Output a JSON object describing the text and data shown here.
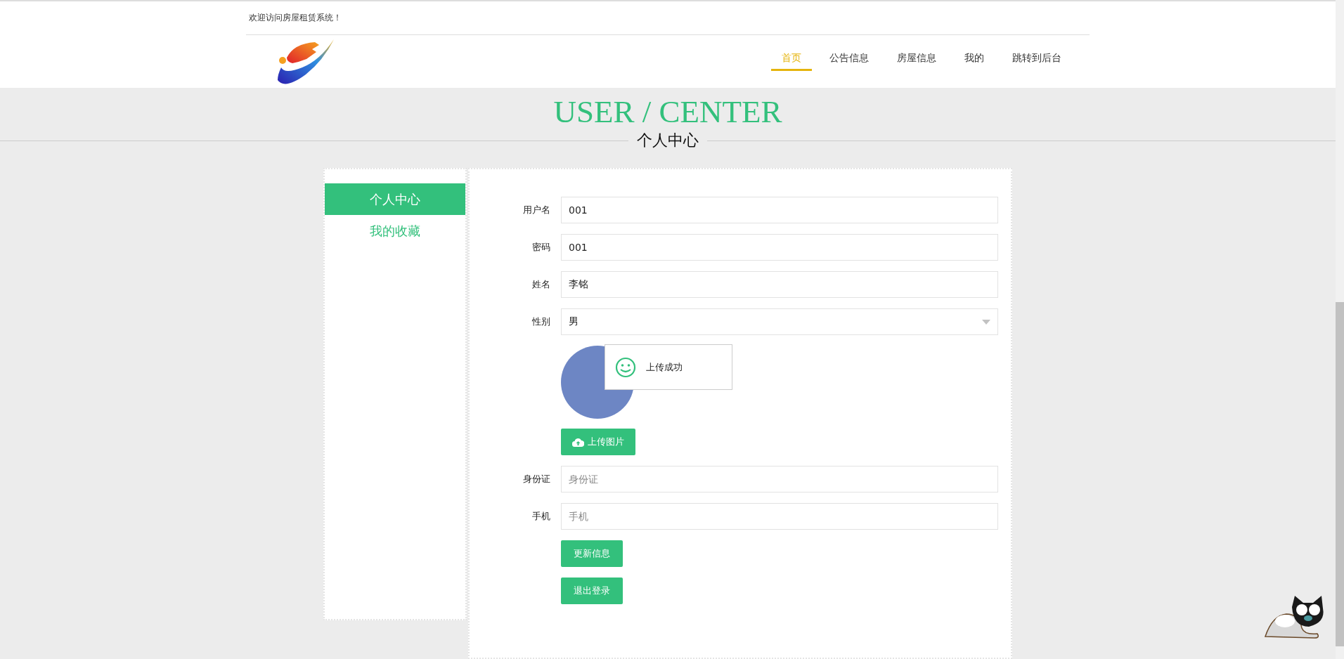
{
  "top_bar": {
    "welcome": "欢迎访问房屋租赁系统！"
  },
  "nav": {
    "items": [
      {
        "label": "首页",
        "selected": true
      },
      {
        "label": "公告信息",
        "selected": false
      },
      {
        "label": "房屋信息",
        "selected": false
      },
      {
        "label": "我的",
        "selected": false
      },
      {
        "label": "跳转到后台",
        "selected": false
      }
    ]
  },
  "banner": {
    "title": "USER / CENTER",
    "subtitle": "个人中心"
  },
  "sidebar": {
    "items": [
      {
        "label": "个人中心",
        "selected": true
      },
      {
        "label": "我的收藏",
        "selected": false
      }
    ]
  },
  "form": {
    "fields": [
      {
        "kind": "input",
        "label": "用户名",
        "value": "001"
      },
      {
        "kind": "input",
        "label": "密码",
        "value": "001"
      },
      {
        "kind": "input",
        "label": "姓名",
        "value": "李铭"
      },
      {
        "kind": "select",
        "label": "性别",
        "value": "男"
      },
      {
        "kind": "avatar",
        "toast": "上传成功",
        "button": "上传图片"
      },
      {
        "kind": "input",
        "label": "身份证",
        "placeholder": "身份证"
      },
      {
        "kind": "input",
        "label": "手机",
        "placeholder": "手机"
      }
    ],
    "buttons": [
      "更新信息",
      "退出登录"
    ]
  }
}
